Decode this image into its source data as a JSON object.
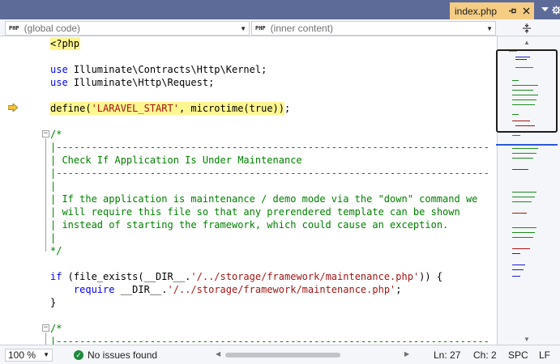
{
  "tab": {
    "filename": "index.php",
    "pin_icon": "pin-icon",
    "close_icon": "close-icon"
  },
  "window": {
    "dropdown_icon": "chevron-down-icon",
    "settings_icon": "gear-icon"
  },
  "navbar": {
    "scope_badge": "PHP",
    "scope_label": "(global code)",
    "member_badge": "PHP",
    "member_label": "(inner content)"
  },
  "code": {
    "lines": [
      {
        "segments": [
          {
            "t": "<?php",
            "c": "plain"
          }
        ]
      },
      {
        "segments": [
          {
            "t": "use",
            "c": "kw"
          },
          {
            "t": " Illuminate\\Contracts\\Http\\Kernel;",
            "c": "plain"
          }
        ]
      },
      {
        "segments": [
          {
            "t": "use",
            "c": "kw"
          },
          {
            "t": " Illuminate\\Http\\Request;",
            "c": "plain"
          }
        ]
      },
      {
        "segments": [
          {
            "t": "define(",
            "c": "plain"
          },
          {
            "t": "'LARAVEL_START'",
            "c": "str"
          },
          {
            "t": ", microtime(true));",
            "c": "plain"
          }
        ]
      },
      {
        "segments": [
          {
            "t": "/*",
            "c": "cmt"
          }
        ]
      },
      {
        "segments": [
          {
            "t": "|--------------------------------------------------------------------------",
            "c": "cmt"
          }
        ]
      },
      {
        "segments": [
          {
            "t": "| Check If Application Is Under Maintenance",
            "c": "cmt"
          }
        ]
      },
      {
        "segments": [
          {
            "t": "|--------------------------------------------------------------------------",
            "c": "cmt"
          }
        ]
      },
      {
        "segments": [
          {
            "t": "|",
            "c": "cmt"
          }
        ]
      },
      {
        "segments": [
          {
            "t": "| If the application is maintenance / demo mode via the \"down\" command we",
            "c": "cmt"
          }
        ]
      },
      {
        "segments": [
          {
            "t": "| will require this file so that any prerendered template can be shown",
            "c": "cmt"
          }
        ]
      },
      {
        "segments": [
          {
            "t": "| instead of starting the framework, which could cause an exception.",
            "c": "cmt"
          }
        ]
      },
      {
        "segments": [
          {
            "t": "|",
            "c": "cmt"
          }
        ]
      },
      {
        "segments": [
          {
            "t": "*/",
            "c": "cmt"
          }
        ]
      },
      {
        "segments": [
          {
            "t": "if",
            "c": "kw"
          },
          {
            "t": " (file_exists(__DIR__.",
            "c": "plain"
          },
          {
            "t": "'/../storage/framework/maintenance.php'",
            "c": "str"
          },
          {
            "t": ")) {",
            "c": "plain"
          }
        ]
      },
      {
        "segments": [
          {
            "t": "    ",
            "c": "plain"
          },
          {
            "t": "require",
            "c": "kw"
          },
          {
            "t": " __DIR__.",
            "c": "plain"
          },
          {
            "t": "'/../storage/framework/maintenance.php'",
            "c": "str"
          },
          {
            "t": ";",
            "c": "plain"
          }
        ]
      },
      {
        "segments": [
          {
            "t": "}",
            "c": "plain"
          }
        ]
      },
      {
        "segments": [
          {
            "t": "/*",
            "c": "cmt"
          }
        ]
      },
      {
        "segments": [
          {
            "t": "|--------------------------------------------------------------------------",
            "c": "cmt"
          }
        ]
      }
    ]
  },
  "status": {
    "zoom": "100 %",
    "issues": "No issues found",
    "line": "Ln: 27",
    "char": "Ch: 2",
    "spacing": "SPC",
    "line_ending": "LF"
  }
}
